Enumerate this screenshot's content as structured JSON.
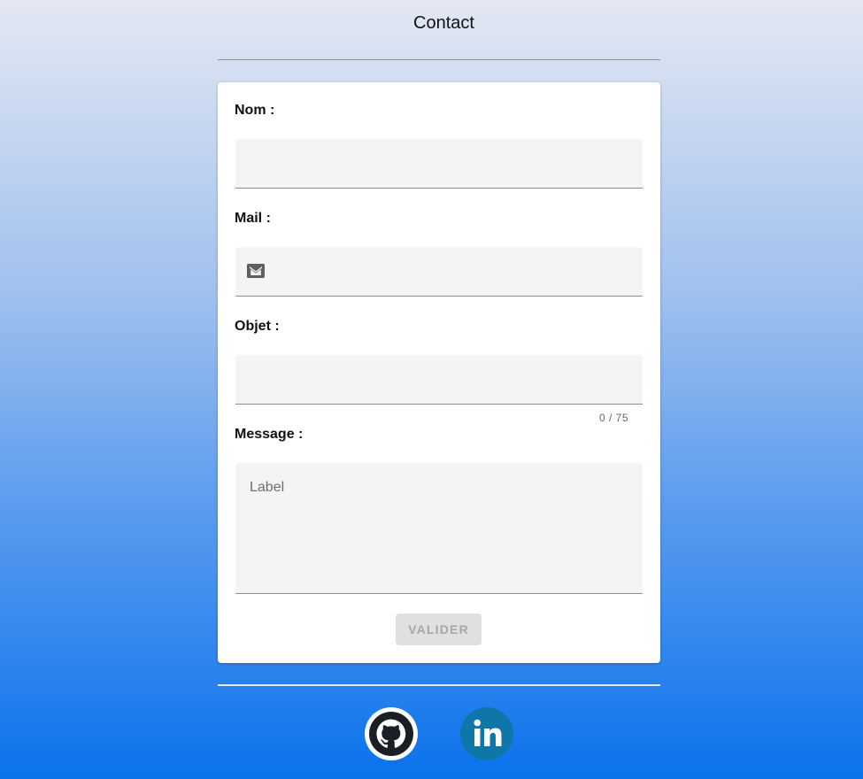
{
  "page": {
    "title": "Contact"
  },
  "form": {
    "nom_label": "Nom :",
    "mail_label": "Mail :",
    "objet_label": "Objet :",
    "objet_counter": "0 / 75",
    "message_label": "Message :",
    "message_placeholder": "Label",
    "submit_label": "VALIDER"
  },
  "icons": {
    "mail": "mail-icon",
    "github": "github-icon",
    "linkedin": "linkedin-icon"
  },
  "colors": {
    "gradient_top": "#e3e8f2",
    "gradient_bottom": "#0a72ec",
    "linkedin": "#0e76a8",
    "github": "#1b1f23"
  }
}
